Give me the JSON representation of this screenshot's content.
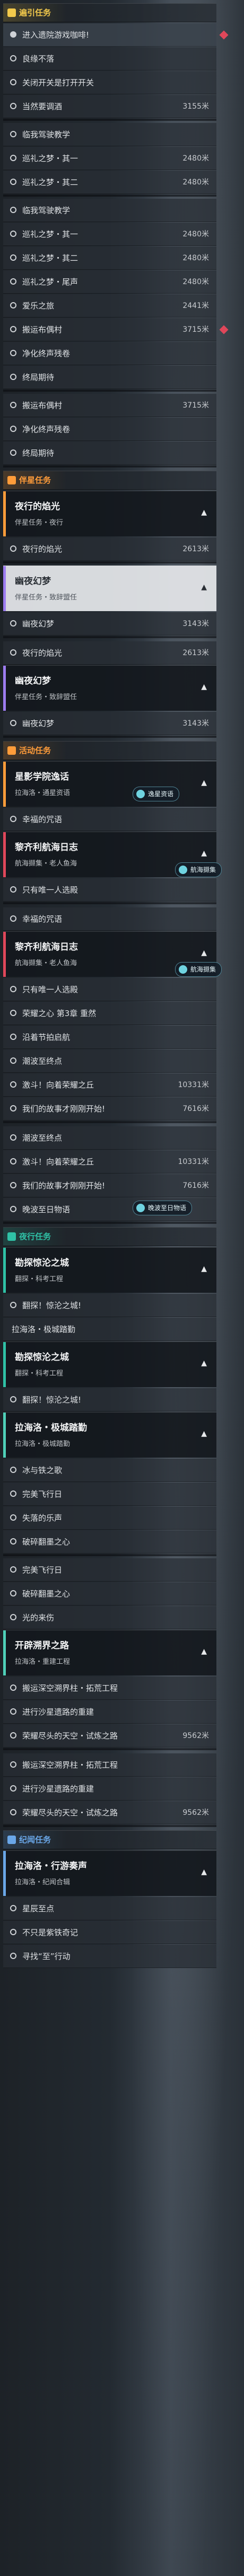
{
  "colors": {
    "yellow": "#f2c94c",
    "orange": "#ff9c3a",
    "purple": "#9d7cf0",
    "teal": "#4fd0b8",
    "green": "#2fc1a6",
    "blue": "#6aa7e8",
    "red": "#e0475a"
  },
  "sec1": {
    "label": "遍引任务",
    "items": [
      {
        "text": "进入遗院游戏咖啡!",
        "dist": "",
        "active": true
      },
      {
        "text": "良缘不落",
        "dist": ""
      },
      {
        "text": "关闭开关是打开开关",
        "dist": ""
      },
      {
        "text": "当然要调酒",
        "dist": "3155米"
      },
      {
        "text": "临我驾驶教学",
        "dist": ""
      },
      {
        "text": "巡礼之梦・其一",
        "dist": "2480米"
      },
      {
        "text": "巡礼之梦・其二",
        "dist": "2480米"
      },
      {
        "text": "临我驾驶教学",
        "dist": ""
      },
      {
        "text": "巡礼之梦・其一",
        "dist": "2480米"
      },
      {
        "text": "巡礼之梦・其二",
        "dist": "2480米"
      },
      {
        "text": "巡礼之梦・尾声",
        "dist": "2480米"
      },
      {
        "text": "爱乐之旅",
        "dist": "2441米"
      },
      {
        "text": "搬运布偶村",
        "dist": "3715米"
      },
      {
        "text": "净化终声残卷",
        "dist": ""
      },
      {
        "text": "终局期待",
        "dist": ""
      },
      {
        "text": "搬运布偶村",
        "dist": "3715米"
      },
      {
        "text": "净化终声残卷",
        "dist": ""
      },
      {
        "text": "终局期待",
        "dist": ""
      }
    ]
  },
  "sec2": {
    "label": "伴星任务",
    "card1": {
      "title": "夜行的焰光",
      "sub": "伴星任务・夜行"
    },
    "row1": {
      "text": "夜行的焰光",
      "dist": "2613米"
    },
    "card2": {
      "title": "幽夜幻梦",
      "sub": "伴星任务・致辞盟任"
    },
    "row2": {
      "text": "幽夜幻梦",
      "dist": "3143米"
    },
    "row3": {
      "text": "夜行的焰光",
      "dist": "2613米"
    },
    "card3": {
      "title": "幽夜幻梦",
      "sub": "伴星任务・致辞盟任"
    },
    "row4": {
      "text": "幽夜幻梦",
      "dist": "3143米"
    }
  },
  "sec3": {
    "label": "活动任务",
    "card1": {
      "title": "星影学院逸话",
      "sub": "拉海洛・通星资语"
    },
    "badge1": "逸星资语",
    "row1": {
      "text": "幸福的咒语",
      "dist": ""
    },
    "card2": {
      "title": "黎齐利航海日志",
      "sub": "航海撷集・老人鱼海"
    },
    "badge2": "航海撷集",
    "rowsA": [
      {
        "text": "只有唯一人选殿",
        "dist": ""
      }
    ],
    "row2": {
      "text": "幸福的咒语",
      "dist": ""
    },
    "card3": {
      "title": "黎齐利航海日志",
      "sub": "航海撷集・老人鱼海"
    },
    "badge3": "航海撷集",
    "rowsB": [
      {
        "text": "只有唯一人选殿",
        "dist": ""
      },
      {
        "text": "荣耀之心 第3章 重然",
        "dist": ""
      },
      {
        "text": "沿着节拍启航",
        "dist": ""
      },
      {
        "text": "潮波至终点",
        "dist": ""
      },
      {
        "text": "激斗！向着荣耀之丘",
        "dist": "10331米"
      },
      {
        "text": "我们的故事才刚刚开始!",
        "dist": "7616米"
      },
      {
        "text": "潮波至终点",
        "dist": ""
      },
      {
        "text": "激斗！向着荣耀之丘",
        "dist": "10331米"
      },
      {
        "text": "我们的故事才刚刚开始!",
        "dist": "7616米"
      },
      {
        "text": "晚波至日物语",
        "dist": ""
      }
    ],
    "badge4": "晚波至日物语"
  },
  "sec4": {
    "label": "夜行任务",
    "card1": {
      "title": "勘探惊沦之城",
      "sub": "翻探・科考工程"
    },
    "row1": {
      "text": "翻探！惊沦之城!",
      "dist": ""
    },
    "card2label": "拉海洛・极城踏勤",
    "card3": {
      "title": "勘探惊沦之城",
      "sub": "翻探・科考工程"
    },
    "row2": {
      "text": "翻探！惊沦之城!",
      "dist": ""
    },
    "card4": {
      "title": "拉海洛・极城踏勤",
      "sub": "拉海洛・极城踏勤"
    },
    "rowsA": [
      {
        "text": "冰与铁之歌",
        "dist": ""
      },
      {
        "text": "完美飞行日",
        "dist": ""
      },
      {
        "text": "失落的乐声",
        "dist": ""
      },
      {
        "text": "破碎翻墨之心",
        "dist": ""
      },
      {
        "text": "完美飞行日",
        "dist": ""
      },
      {
        "text": "破碎翻墨之心",
        "dist": ""
      },
      {
        "text": "光的来伤",
        "dist": ""
      }
    ],
    "card5": {
      "title": "开辟溯界之路",
      "sub": "拉海洛・重建工程"
    },
    "rowsB": [
      {
        "text": "搬运深空溯界柱・拓荒工程",
        "dist": ""
      },
      {
        "text": "进行沙星遗路的重建",
        "dist": ""
      },
      {
        "text": "荣耀尽头的天空・试炼之路",
        "dist": "9562米"
      },
      {
        "text": "搬运深空溯界柱・拓荒工程",
        "dist": ""
      },
      {
        "text": "进行沙星遗路的重建",
        "dist": ""
      },
      {
        "text": "荣耀尽头的天空・试炼之路",
        "dist": "9562米"
      }
    ]
  },
  "sec5": {
    "label": "纪闻任务",
    "card1": {
      "title": "拉海洛・行游奏声",
      "sub": "拉海洛・纪闻合辑"
    },
    "rows": [
      {
        "text": "星辰至点",
        "dist": ""
      },
      {
        "text": "不只是紫铁奇记",
        "dist": ""
      },
      {
        "text": "寻找“至”行动",
        "dist": ""
      }
    ]
  }
}
